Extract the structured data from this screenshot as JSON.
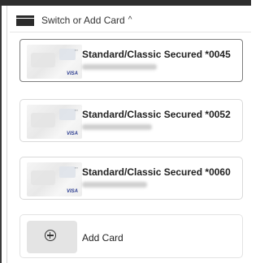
{
  "header": {
    "label": "Switch or Add Card",
    "caret": "^",
    "icon": "credit-card-icon"
  },
  "cards": [
    {
      "title": "Standard/Classic Secured *0045",
      "network": "VISA",
      "selected": true
    },
    {
      "title": "Standard/Classic Secured *0052",
      "network": "VISA",
      "selected": false
    },
    {
      "title": "Standard/Classic Secured *0060",
      "network": "VISA",
      "selected": false
    }
  ],
  "add_card": {
    "label": "Add Card",
    "icon": "plus-circle-icon"
  },
  "colors": {
    "text": "#222222",
    "selected_border": "#7d7d7d",
    "card_border": "#d9d9d9",
    "add_tile": "#e4e4e4"
  }
}
